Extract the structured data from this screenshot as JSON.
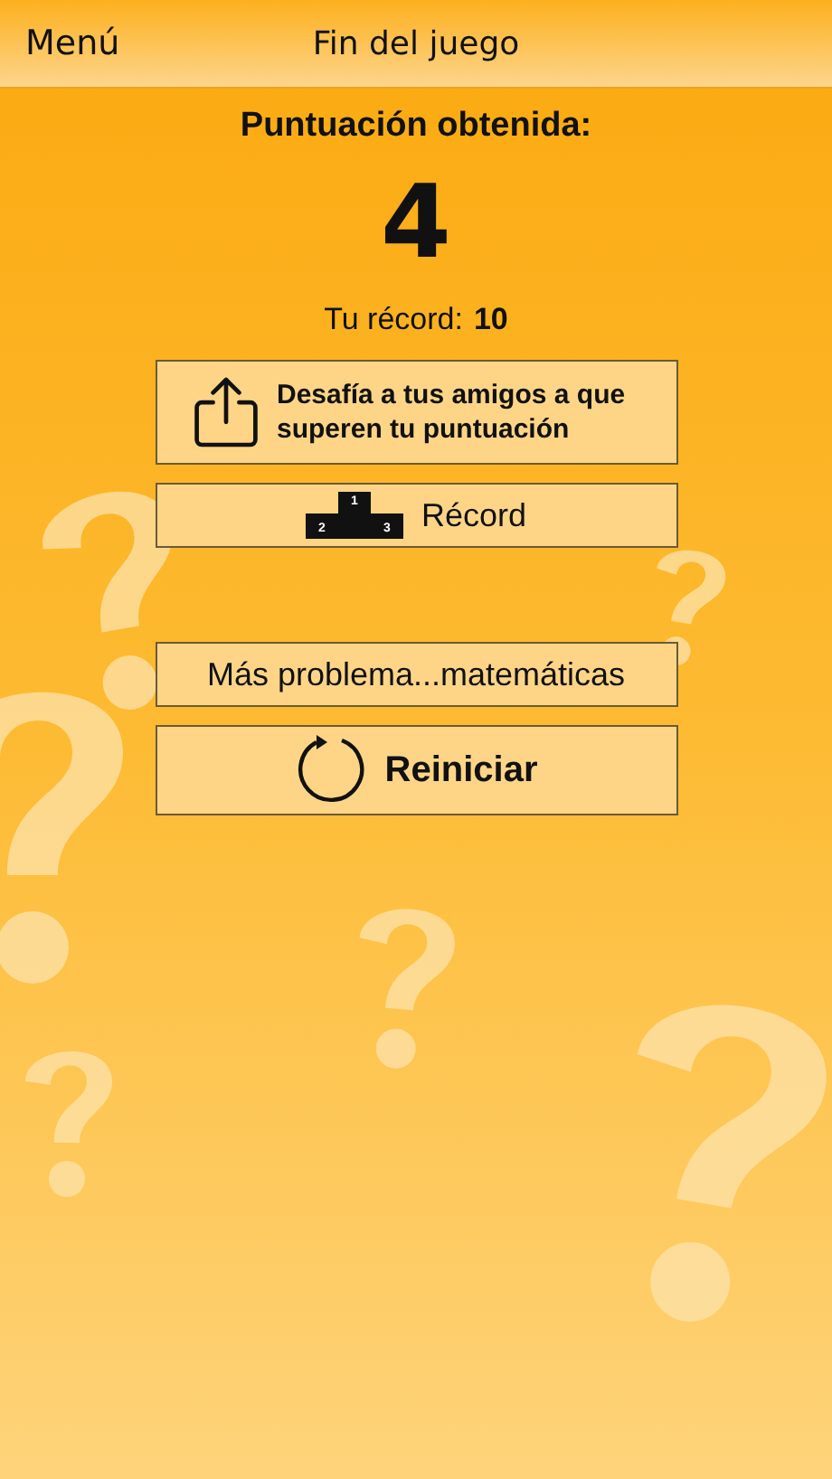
{
  "nav_bar": {
    "back": "Menú",
    "title": "Fin del juego"
  },
  "score": {
    "label": "Puntuación obtenida:",
    "value": "4",
    "record_label": "Tu récord:",
    "record_value": "10"
  },
  "buttons": [
    {
      "kind": "share",
      "label": "Desafía a tus amigos a que superen tu puntuación",
      "bold": true
    },
    {
      "kind": "podium",
      "label": "Récord",
      "bold": false,
      "podium": [
        "2",
        "1",
        "3"
      ]
    },
    {
      "kind": "plain",
      "label": "Más problema...matemáticas",
      "bold": false
    },
    {
      "kind": "restart",
      "label": "Reiniciar",
      "bold": true
    }
  ]
}
